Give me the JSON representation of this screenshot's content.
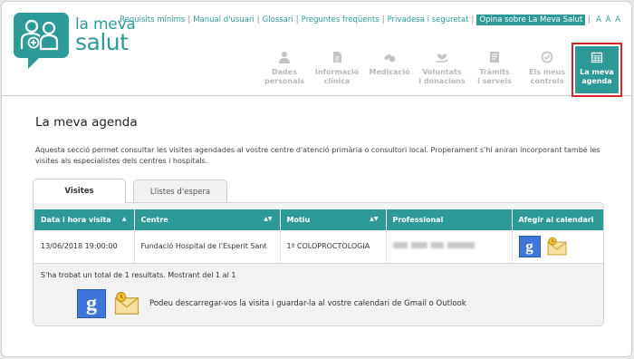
{
  "logo": {
    "line1": "la meva",
    "line2": "salut"
  },
  "toplinks": {
    "items": [
      "Requisits mínims",
      "Manual d'usuari",
      "Glossari",
      "Preguntes freqüents",
      "Privadesa i seguretat"
    ],
    "highlight": "Opina sobre La Meva Salut",
    "font_sizes": "A A A"
  },
  "nav": {
    "items": [
      {
        "line1": "Dades",
        "line2": "personals",
        "icon": "person-icon"
      },
      {
        "line1": "Informació",
        "line2": "clínica",
        "icon": "document-icon"
      },
      {
        "line1": "Medicació",
        "line2": "",
        "icon": "pills-icon"
      },
      {
        "line1": "Voluntats",
        "line2": "i donacions",
        "icon": "heart-hand-icon"
      },
      {
        "line1": "Tràmits",
        "line2": "i serveis",
        "icon": "form-icon"
      },
      {
        "line1": "Els meus",
        "line2": "controls",
        "icon": "check-circle-icon"
      }
    ],
    "active": {
      "line1": "La meva",
      "line2": "agenda",
      "icon": "calendar-icon"
    }
  },
  "page": {
    "title": "La meva agenda",
    "description": "Aquesta secció permet consultar les visites agendades al vostre centre d'atenció primària o consultori local. Properament s'hi aniran incorporant també les visites als especialistes dels centres i hospitals."
  },
  "tabs": {
    "visits": "Visites",
    "waiting": "Llistes d'espera"
  },
  "table": {
    "headers": [
      "Data i hora visita",
      "Centre",
      "Motiu",
      "Professional",
      "Afegir al calendari"
    ],
    "rows": [
      {
        "date": "13/06/2018 19:00:00",
        "centre": "Fundació Hospital de l'Esperit Sant",
        "reason": "1º COLOPROCTOLOGIA",
        "professional": ""
      }
    ]
  },
  "summary": "S'ha trobat un total de 1 resultats. Mostrant del 1 al 1",
  "note": "Podeu descarregar-vos la visita i guardar-la al vostre calendari de Gmail o Outlook",
  "colors": {
    "accent": "#2e9a98",
    "active_border": "#d6262c"
  }
}
